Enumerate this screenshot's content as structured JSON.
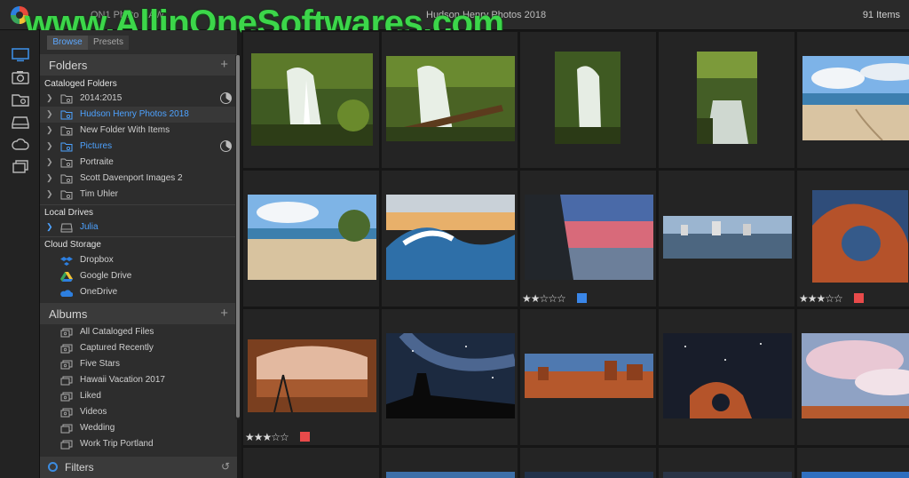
{
  "app": {
    "name": "ON1 Photo RAW",
    "title": "Hudson Henry Photos 2018",
    "item_count": "91 Items"
  },
  "watermark": "www.AllinOneSoftwares.com",
  "rail": {
    "icons": [
      "monitor-icon",
      "camera-icon",
      "folder-search-icon",
      "drive-icon",
      "cloud-icon",
      "albums-icon"
    ]
  },
  "sidebar": {
    "tabs": {
      "browse": "Browse",
      "presets": "Presets"
    },
    "folders": {
      "title": "Folders",
      "add": "+",
      "cataloged_label": "Cataloged Folders",
      "cataloged": [
        {
          "label": "2014:2015",
          "selected": false,
          "has_progress": true
        },
        {
          "label": "Hudson Henry Photos 2018",
          "selected": true,
          "has_progress": false
        },
        {
          "label": "New Folder With Items",
          "selected": false,
          "has_progress": false
        },
        {
          "label": "Pictures",
          "selected": false,
          "has_progress": true
        },
        {
          "label": "Portraite",
          "selected": false,
          "has_progress": false
        },
        {
          "label": "Scott Davenport Images 2",
          "selected": false,
          "has_progress": false
        },
        {
          "label": "Tim Uhler",
          "selected": false,
          "has_progress": false
        }
      ],
      "local_label": "Local Drives",
      "local": [
        {
          "label": "Julia"
        }
      ],
      "cloud_label": "Cloud Storage",
      "cloud": [
        {
          "label": "Dropbox"
        },
        {
          "label": "Google Drive"
        },
        {
          "label": "OneDrive"
        }
      ]
    },
    "albums": {
      "title": "Albums",
      "add": "+",
      "items": [
        {
          "label": "All Cataloged Files"
        },
        {
          "label": "Captured Recently"
        },
        {
          "label": "Five Stars"
        },
        {
          "label": "Hawaii Vacation 2017"
        },
        {
          "label": "Liked"
        },
        {
          "label": "Videos"
        },
        {
          "label": "Wedding"
        },
        {
          "label": "Work Trip Portland"
        }
      ]
    },
    "filters": {
      "title": "Filters",
      "reset": "↺"
    }
  },
  "grid": {
    "ratings": [
      {
        "stars": "★★☆☆☆",
        "value": 2,
        "color": "#3a86e8"
      },
      {
        "stars": "★★★☆☆",
        "value": 3,
        "color": "#e84a4a"
      },
      {
        "stars": "★★★☆☆",
        "value": 3,
        "color": "#e84a4a"
      }
    ]
  },
  "colors": {
    "accent": "#4da2ff",
    "label_blue": "#3a86e8",
    "label_red": "#e84a4a"
  }
}
